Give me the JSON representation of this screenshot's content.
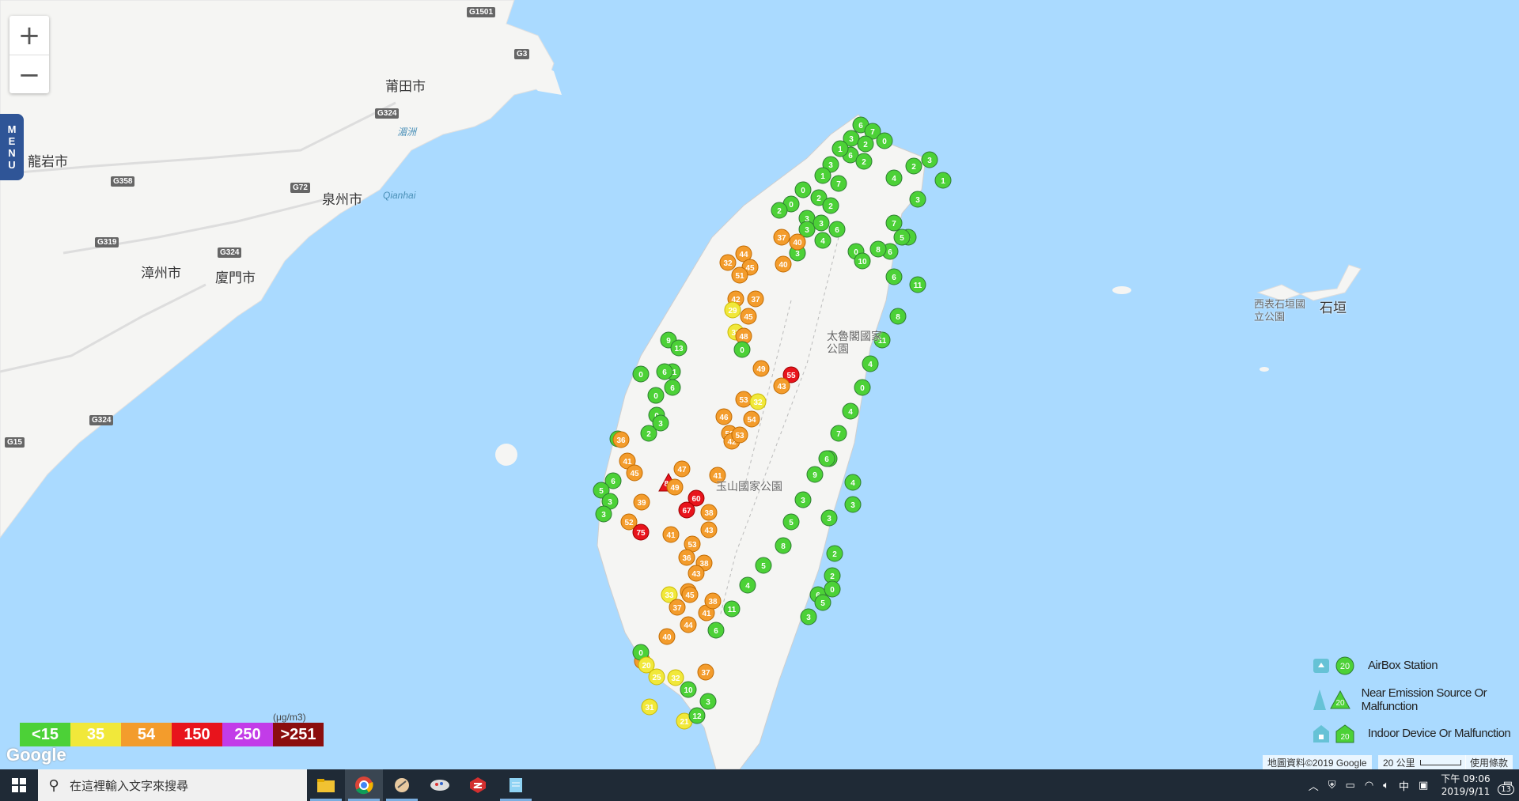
{
  "controls": {
    "zoom_in": "+",
    "zoom_out": "−",
    "menu_letters": [
      "M",
      "E",
      "N",
      "U"
    ]
  },
  "cities": [
    {
      "name": "莆田市"
    },
    {
      "name": "龍岩市"
    },
    {
      "name": "泉州市"
    },
    {
      "name": "漳州市"
    },
    {
      "name": "廈門市"
    },
    {
      "name": "石垣"
    }
  ],
  "roads": [
    "G1501",
    "G3",
    "G324",
    "G358",
    "G72",
    "G319",
    "G324",
    "G324",
    "G15"
  ],
  "water_labels": [
    "Qianhai",
    "湄洲"
  ],
  "parks": [
    "太魯閣國家公園",
    "玉山國家公園",
    "西表石垣國立公園"
  ],
  "pm_scale": {
    "unit": "(μg/m3)",
    "segments": [
      {
        "label": "<15",
        "color": "#4cd137"
      },
      {
        "label": "35",
        "color": "#f1e83a"
      },
      {
        "label": "54",
        "color": "#f39c2c"
      },
      {
        "label": "150",
        "color": "#e8141c"
      },
      {
        "label": "250",
        "color": "#c23ce8"
      },
      {
        "label": ">251",
        "color": "#8b0e0e"
      }
    ]
  },
  "legend": [
    {
      "label": "AirBox Station",
      "icon": "airbox-station-icon"
    },
    {
      "label": "Near Emission Source Or Malfunction",
      "icon": "emission-source-icon"
    },
    {
      "label": "Indoor Device Or Malfunction",
      "icon": "indoor-device-icon"
    }
  ],
  "legend_sample_value": "20",
  "google_logo": "Google",
  "attribution": {
    "map_data": "地圖資料©2019 Google",
    "scale": "20 公里",
    "terms": "使用條款"
  },
  "taskbar": {
    "search_placeholder": "在這裡輸入文字來搜尋",
    "apps": [
      "file-explorer-icon",
      "chrome-icon",
      "app-icon",
      "app-icon",
      "sketchup-icon",
      "notepad-icon"
    ],
    "tray_ime": "中",
    "time": "下午 09:06",
    "date": "2019/9/11",
    "notification_count": "13"
  },
  "colors": {
    "sea": "#aadaff",
    "land": "#f5f5f3",
    "green": "#4cd137",
    "yellow": "#f1e83a",
    "orange": "#f39c2c",
    "red": "#e8141c"
  },
  "markers": [
    {
      "v": "6",
      "c": "g",
      "s": "c"
    },
    {
      "v": "7",
      "c": "g",
      "s": "c"
    },
    {
      "v": "3",
      "c": "g",
      "s": "c"
    },
    {
      "v": "2",
      "c": "g",
      "s": "c"
    },
    {
      "v": "0",
      "c": "g",
      "s": "c"
    },
    {
      "v": "6",
      "c": "g",
      "s": "c"
    },
    {
      "v": "2",
      "c": "g",
      "s": "c"
    },
    {
      "v": "1",
      "c": "g",
      "s": "c"
    },
    {
      "v": "3",
      "c": "g",
      "s": "c"
    },
    {
      "v": "1",
      "c": "g",
      "s": "c"
    },
    {
      "v": "0",
      "c": "g",
      "s": "c"
    },
    {
      "v": "2",
      "c": "g",
      "s": "c"
    },
    {
      "v": "2",
      "c": "g",
      "s": "c"
    },
    {
      "v": "3",
      "c": "g",
      "s": "c"
    },
    {
      "v": "0",
      "c": "g",
      "s": "c"
    },
    {
      "v": "2",
      "c": "g",
      "s": "c"
    },
    {
      "v": "7",
      "c": "g",
      "s": "c"
    },
    {
      "v": "4",
      "c": "g",
      "s": "c"
    },
    {
      "v": "2",
      "c": "g",
      "s": "c"
    },
    {
      "v": "3",
      "c": "g",
      "s": "c"
    },
    {
      "v": "1",
      "c": "g",
      "s": "c"
    },
    {
      "v": "3",
      "c": "g",
      "s": "c"
    },
    {
      "v": "7",
      "c": "g",
      "s": "c"
    },
    {
      "v": "3",
      "c": "g",
      "s": "c"
    },
    {
      "v": "6",
      "c": "g",
      "s": "c"
    },
    {
      "v": "0",
      "c": "g",
      "s": "c"
    },
    {
      "v": "6",
      "c": "g",
      "s": "c"
    },
    {
      "v": "4",
      "c": "g",
      "s": "c"
    },
    {
      "v": "3",
      "c": "g",
      "s": "c"
    },
    {
      "v": "3",
      "c": "g",
      "s": "c"
    },
    {
      "v": "8",
      "c": "g",
      "s": "c"
    },
    {
      "v": "5",
      "c": "g",
      "s": "c"
    },
    {
      "v": "10",
      "c": "g",
      "s": "c"
    },
    {
      "v": "6",
      "c": "g",
      "s": "c"
    },
    {
      "v": "11",
      "c": "g",
      "s": "c"
    },
    {
      "v": "8",
      "c": "g",
      "s": "c"
    },
    {
      "v": "11",
      "c": "g",
      "s": "c"
    },
    {
      "v": "4",
      "c": "g",
      "s": "c"
    },
    {
      "v": "0",
      "c": "g",
      "s": "c"
    },
    {
      "v": "4",
      "c": "g",
      "s": "c"
    },
    {
      "v": "7",
      "c": "g",
      "s": "c"
    },
    {
      "v": "8",
      "c": "g",
      "s": "c"
    },
    {
      "v": "9",
      "c": "g",
      "s": "c"
    },
    {
      "v": "3",
      "c": "g",
      "s": "c"
    },
    {
      "v": "5",
      "c": "g",
      "s": "c"
    },
    {
      "v": "8",
      "c": "g",
      "s": "c"
    },
    {
      "v": "5",
      "c": "g",
      "s": "c"
    },
    {
      "v": "4",
      "c": "g",
      "s": "c"
    },
    {
      "v": "11",
      "c": "g",
      "s": "c"
    },
    {
      "v": "6",
      "c": "g",
      "s": "c"
    },
    {
      "v": "6",
      "c": "g",
      "s": "c"
    },
    {
      "v": "4",
      "c": "g",
      "s": "c"
    },
    {
      "v": "3",
      "c": "g",
      "s": "c"
    },
    {
      "v": "3",
      "c": "g",
      "s": "c"
    },
    {
      "v": "2",
      "c": "g",
      "s": "c"
    },
    {
      "v": "2",
      "c": "g",
      "s": "c"
    },
    {
      "v": "3",
      "c": "g",
      "s": "c"
    },
    {
      "v": "6",
      "c": "g",
      "s": "c"
    },
    {
      "v": "5",
      "c": "g",
      "s": "c"
    },
    {
      "v": "0",
      "c": "g",
      "s": "c"
    },
    {
      "v": "3",
      "c": "g",
      "s": "c"
    },
    {
      "v": "37",
      "c": "o",
      "s": "c"
    },
    {
      "v": "40",
      "c": "o",
      "s": "c"
    },
    {
      "v": "40",
      "c": "o",
      "s": "c"
    },
    {
      "v": "32",
      "c": "o",
      "s": "c"
    },
    {
      "v": "44",
      "c": "o",
      "s": "c"
    },
    {
      "v": "45",
      "c": "o",
      "s": "c"
    },
    {
      "v": "51",
      "c": "o",
      "s": "c"
    },
    {
      "v": "42",
      "c": "o",
      "s": "c"
    },
    {
      "v": "37",
      "c": "o",
      "s": "c"
    },
    {
      "v": "29",
      "c": "y",
      "s": "c"
    },
    {
      "v": "33",
      "c": "y",
      "s": "c"
    },
    {
      "v": "45",
      "c": "o",
      "s": "c"
    },
    {
      "v": "48",
      "c": "o",
      "s": "c"
    },
    {
      "v": "0",
      "c": "g",
      "s": "c"
    },
    {
      "v": "49",
      "c": "o",
      "s": "c"
    },
    {
      "v": "55",
      "c": "r",
      "s": "c"
    },
    {
      "v": "43",
      "c": "o",
      "s": "c"
    },
    {
      "v": "53",
      "c": "o",
      "s": "c"
    },
    {
      "v": "32",
      "c": "y",
      "s": "c"
    },
    {
      "v": "54",
      "c": "o",
      "s": "c"
    },
    {
      "v": "46",
      "c": "o",
      "s": "c"
    },
    {
      "v": "50",
      "c": "o",
      "s": "c"
    },
    {
      "v": "42",
      "c": "o",
      "s": "c"
    },
    {
      "v": "53",
      "c": "o",
      "s": "c"
    },
    {
      "v": "47",
      "c": "o",
      "s": "c"
    },
    {
      "v": "81",
      "c": "r",
      "s": "t"
    },
    {
      "v": "49",
      "c": "o",
      "s": "c"
    },
    {
      "v": "41",
      "c": "o",
      "s": "c"
    },
    {
      "v": "60",
      "c": "r",
      "s": "c"
    },
    {
      "v": "67",
      "c": "r",
      "s": "c"
    },
    {
      "v": "38",
      "c": "o",
      "s": "c"
    },
    {
      "v": "39",
      "c": "o",
      "s": "c"
    },
    {
      "v": "52",
      "c": "o",
      "s": "c"
    },
    {
      "v": "75",
      "c": "r",
      "s": "c"
    },
    {
      "v": "41",
      "c": "o",
      "s": "c"
    },
    {
      "v": "43",
      "c": "o",
      "s": "c"
    },
    {
      "v": "53",
      "c": "o",
      "s": "c"
    },
    {
      "v": "36",
      "c": "o",
      "s": "c"
    },
    {
      "v": "38",
      "c": "o",
      "s": "c"
    },
    {
      "v": "43",
      "c": "o",
      "s": "c"
    },
    {
      "v": "44",
      "c": "o",
      "s": "c"
    },
    {
      "v": "45",
      "c": "o",
      "s": "c"
    },
    {
      "v": "33",
      "c": "y",
      "s": "c"
    },
    {
      "v": "37",
      "c": "o",
      "s": "c"
    },
    {
      "v": "41",
      "c": "o",
      "s": "c"
    },
    {
      "v": "44",
      "c": "o",
      "s": "c"
    },
    {
      "v": "40",
      "c": "o",
      "s": "c"
    },
    {
      "v": "37",
      "c": "o",
      "s": "c"
    },
    {
      "v": "32",
      "c": "y",
      "s": "c"
    },
    {
      "v": "37",
      "c": "o",
      "s": "c"
    },
    {
      "v": "38",
      "c": "o",
      "s": "c"
    },
    {
      "v": "31",
      "c": "y",
      "s": "c"
    },
    {
      "v": "0",
      "c": "g",
      "s": "c"
    },
    {
      "v": "20",
      "c": "y",
      "s": "c"
    },
    {
      "v": "25",
      "c": "y",
      "s": "c"
    },
    {
      "v": "21",
      "c": "y",
      "s": "c"
    },
    {
      "v": "12",
      "c": "g",
      "s": "c"
    },
    {
      "v": "10",
      "c": "g",
      "s": "c"
    },
    {
      "v": "3",
      "c": "g",
      "s": "c"
    },
    {
      "v": "0",
      "c": "g",
      "s": "c"
    },
    {
      "v": "0",
      "c": "g",
      "s": "c"
    },
    {
      "v": "3",
      "c": "g",
      "s": "c"
    },
    {
      "v": "2",
      "c": "g",
      "s": "c"
    },
    {
      "v": "5",
      "c": "g",
      "s": "c"
    },
    {
      "v": "9",
      "c": "g",
      "s": "c"
    },
    {
      "v": "13",
      "c": "g",
      "s": "c"
    },
    {
      "v": "6",
      "c": "g",
      "s": "c"
    },
    {
      "v": "11",
      "c": "g",
      "s": "c"
    },
    {
      "v": "6",
      "c": "g",
      "s": "c"
    },
    {
      "v": "0",
      "c": "g",
      "s": "c"
    },
    {
      "v": "36",
      "c": "o",
      "s": "c"
    },
    {
      "v": "41",
      "c": "o",
      "s": "c"
    },
    {
      "v": "45",
      "c": "o",
      "s": "c"
    },
    {
      "v": "6",
      "c": "g",
      "s": "c"
    },
    {
      "v": "5",
      "c": "g",
      "s": "c"
    },
    {
      "v": "3",
      "c": "g",
      "s": "c"
    },
    {
      "v": "3",
      "c": "g",
      "s": "c"
    }
  ]
}
